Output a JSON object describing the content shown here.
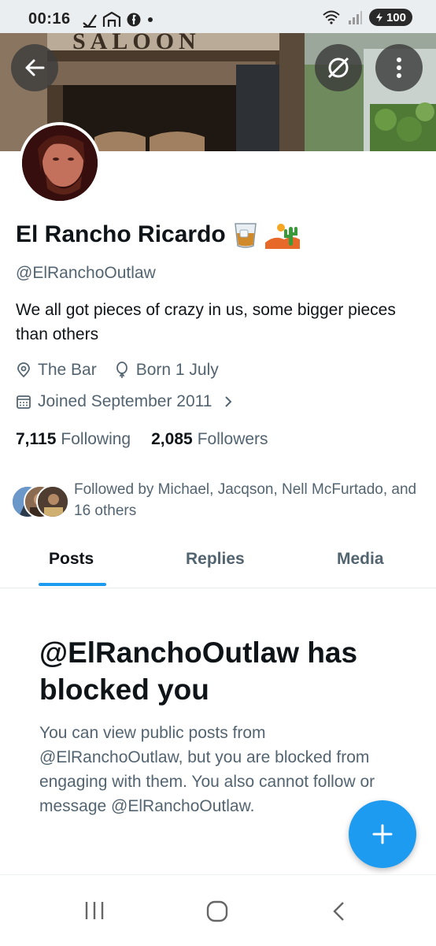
{
  "status_bar": {
    "time": "00:16",
    "battery": "100"
  },
  "banner": {
    "sign_text": "SALOON"
  },
  "profile": {
    "name": "El Rancho Ricardo",
    "name_emoji": [
      "tumbler-glass",
      "desert",
      "cactus"
    ],
    "handle": "@ElRanchoOutlaw",
    "bio": "We all got pieces of crazy in us, some bigger pieces than others",
    "location": "The Bar",
    "birthday": "Born 1 July",
    "joined": "Joined September 2011",
    "following_count": "7,115",
    "following_label": "Following",
    "followers_count": "2,085",
    "followers_label": "Followers",
    "followed_by": "Followed by Michael, Jacqson, Nell McFurtado, and 16 others"
  },
  "tabs": [
    {
      "label": "Posts",
      "active": true
    },
    {
      "label": "Replies",
      "active": false
    },
    {
      "label": "Media",
      "active": false
    }
  ],
  "blocked": {
    "title": "@ElRanchoOutlaw has blocked you",
    "description": "You can view public posts from @ElRanchoOutlaw, but you are blocked from engaging with them. You also cannot follow or message @ElRanchoOutlaw."
  },
  "colors": {
    "accent": "#1d9bf0",
    "text_primary": "#0f1419",
    "text_secondary": "#536471"
  },
  "icons": [
    "back-arrow-icon",
    "grok-icon",
    "more-vertical-icon",
    "location-icon",
    "birthday-icon",
    "calendar-icon",
    "chevron-right-icon",
    "plus-icon"
  ]
}
